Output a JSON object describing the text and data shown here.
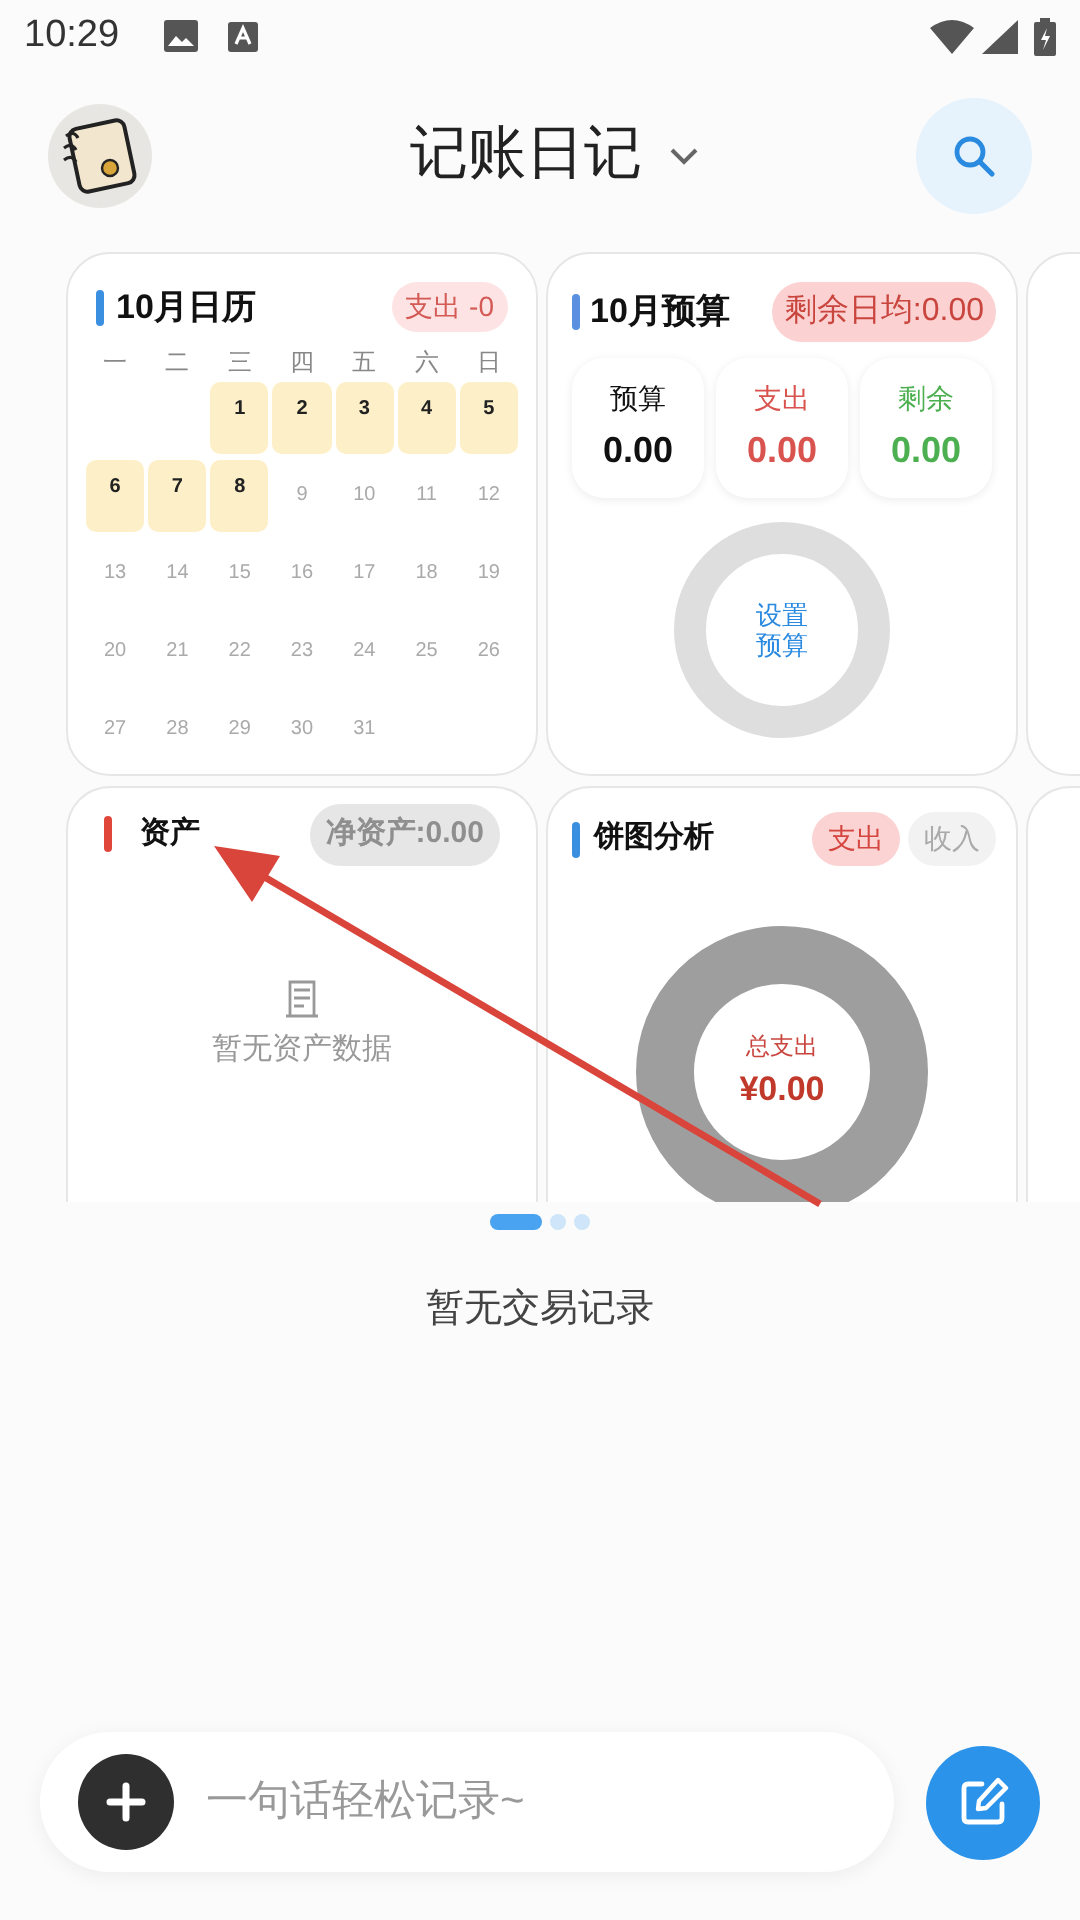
{
  "status_bar": {
    "time": "10:29"
  },
  "header": {
    "title": "记账日记"
  },
  "calendar": {
    "title": "10月日历",
    "badge": "支出 -0",
    "weekdays": [
      "一",
      "二",
      "三",
      "四",
      "五",
      "六",
      "日"
    ],
    "weeks": [
      {
        "cells": [
          {
            "kind": "blank"
          },
          {
            "kind": "blank"
          },
          {
            "kind": "day",
            "text": "1",
            "highlighted": true
          },
          {
            "kind": "day",
            "text": "2",
            "highlighted": true
          },
          {
            "kind": "day",
            "text": "3",
            "highlighted": true
          },
          {
            "kind": "day",
            "text": "4",
            "highlighted": true
          },
          {
            "kind": "day",
            "text": "5",
            "highlighted": true
          }
        ]
      },
      {
        "cells": [
          {
            "kind": "day",
            "text": "6",
            "highlighted": true
          },
          {
            "kind": "day",
            "text": "7",
            "highlighted": true
          },
          {
            "kind": "day",
            "text": "8",
            "highlighted": true
          },
          {
            "kind": "day",
            "text": "9",
            "highlighted": false
          },
          {
            "kind": "day",
            "text": "10",
            "highlighted": false
          },
          {
            "kind": "day",
            "text": "11",
            "highlighted": false
          },
          {
            "kind": "day",
            "text": "12",
            "highlighted": false
          }
        ]
      },
      {
        "cells": [
          {
            "kind": "day",
            "text": "13",
            "highlighted": false
          },
          {
            "kind": "day",
            "text": "14",
            "highlighted": false
          },
          {
            "kind": "day",
            "text": "15",
            "highlighted": false
          },
          {
            "kind": "day",
            "text": "16",
            "highlighted": false
          },
          {
            "kind": "day",
            "text": "17",
            "highlighted": false
          },
          {
            "kind": "day",
            "text": "18",
            "highlighted": false
          },
          {
            "kind": "day",
            "text": "19",
            "highlighted": false
          }
        ]
      },
      {
        "cells": [
          {
            "kind": "day",
            "text": "20",
            "highlighted": false
          },
          {
            "kind": "day",
            "text": "21",
            "highlighted": false
          },
          {
            "kind": "day",
            "text": "22",
            "highlighted": false
          },
          {
            "kind": "day",
            "text": "23",
            "highlighted": false
          },
          {
            "kind": "day",
            "text": "24",
            "highlighted": false
          },
          {
            "kind": "day",
            "text": "25",
            "highlighted": false
          },
          {
            "kind": "day",
            "text": "26",
            "highlighted": false
          }
        ]
      },
      {
        "cells": [
          {
            "kind": "day",
            "text": "27",
            "highlighted": false
          },
          {
            "kind": "day",
            "text": "28",
            "highlighted": false
          },
          {
            "kind": "day",
            "text": "29",
            "highlighted": false
          },
          {
            "kind": "day",
            "text": "30",
            "highlighted": false
          },
          {
            "kind": "day",
            "text": "31",
            "highlighted": false
          }
        ]
      }
    ]
  },
  "budget": {
    "title": "10月预算",
    "badge": "剩余日均:0.00",
    "stats": [
      {
        "label": "预算",
        "value": "0.00",
        "color": "#111111"
      },
      {
        "label": "支出",
        "value": "0.00",
        "color": "#d9534f"
      },
      {
        "label": "剩余",
        "value": "0.00",
        "color": "#4caf50"
      }
    ],
    "ring_label": "设置预算"
  },
  "assets": {
    "title": "资产",
    "badge": "净资产:0.00",
    "empty_text": "暂无资产数据"
  },
  "pie": {
    "title": "饼图分析",
    "toggles": [
      {
        "label": "支出",
        "selected": true
      },
      {
        "label": "收入",
        "selected": false
      }
    ],
    "center_label": "总支出",
    "center_value": "¥0.00"
  },
  "pager": [
    {
      "selected": true
    },
    {
      "selected": false
    },
    {
      "selected": false
    }
  ],
  "empty_transactions": "暂无交易记录",
  "input": {
    "placeholder": "一句话轻松记录~"
  }
}
